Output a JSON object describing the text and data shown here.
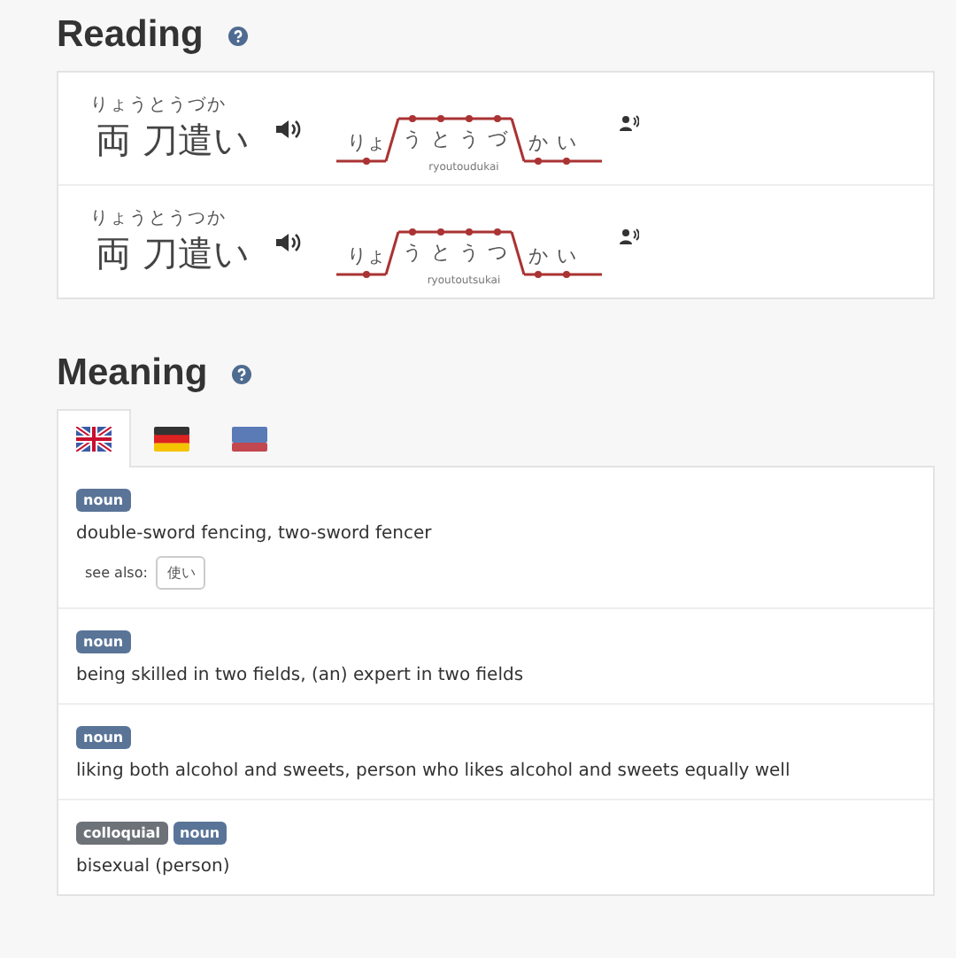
{
  "reading": {
    "title": "Reading",
    "entries": [
      {
        "furigana": "りょうとうづか",
        "kanji": "両 刀遣い",
        "romaji": "ryoutoudukai",
        "pitch": [
          {
            "morae": [
              "りょ"
            ],
            "high": false
          },
          {
            "morae": [
              "う",
              "と",
              "う",
              "づ"
            ],
            "high": true
          },
          {
            "morae": [
              "か",
              "い"
            ],
            "high": false
          }
        ]
      },
      {
        "furigana": "りょうとうつか",
        "kanji": "両 刀遣い",
        "romaji": "ryoutoutsukai",
        "pitch": [
          {
            "morae": [
              "りょ"
            ],
            "high": false
          },
          {
            "morae": [
              "う",
              "と",
              "う",
              "つ"
            ],
            "high": true
          },
          {
            "morae": [
              "か",
              "い"
            ],
            "high": false
          }
        ]
      }
    ]
  },
  "meaning": {
    "title": "Meaning",
    "tabs": [
      {
        "kind": "uk",
        "selected": true
      },
      {
        "kind": "de",
        "selected": false
      },
      {
        "kind": "ru",
        "selected": false
      }
    ],
    "senses": [
      {
        "tags": [
          {
            "label": "noun",
            "kind": "pos"
          }
        ],
        "gloss": "double-sword fencing, two-sword fencer",
        "see_also": {
          "label": "see also:",
          "links": [
            "使い"
          ]
        }
      },
      {
        "tags": [
          {
            "label": "noun",
            "kind": "pos"
          }
        ],
        "gloss": "being skilled in two fields, (an) expert in two fields"
      },
      {
        "tags": [
          {
            "label": "noun",
            "kind": "pos"
          }
        ],
        "gloss": "liking both alcohol and sweets, person who likes alcohol and sweets equally well"
      },
      {
        "tags": [
          {
            "label": "colloquial",
            "kind": "misc"
          },
          {
            "label": "noun",
            "kind": "pos"
          }
        ],
        "gloss": "bisexual (person)"
      }
    ]
  }
}
